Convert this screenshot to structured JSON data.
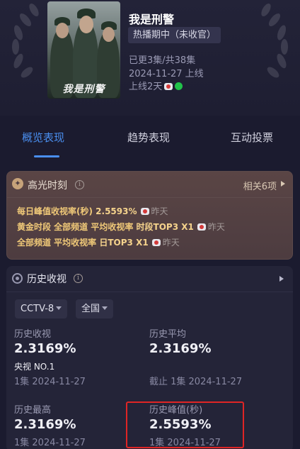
{
  "show": {
    "title": "我是刑警",
    "poster_text": "我是刑警",
    "status": "热播期中（未收官）",
    "episodes": "已更3集/共38集",
    "premiere": "2024-11-27 上线",
    "online_days": "上线2天"
  },
  "tabs": [
    {
      "label": "概览表现",
      "active": true
    },
    {
      "label": "趋势表现",
      "active": false
    },
    {
      "label": "互动投票",
      "active": false
    }
  ],
  "highlights": {
    "title": "高光时刻",
    "info_glyph": "i",
    "related": "相关6项",
    "items": [
      {
        "label": "每日峰值收视率(秒)",
        "value": "2.5593%",
        "when": "昨天"
      },
      {
        "label": "黄金时段 全部频道 平均收视率",
        "value": "时段TOP3 X1",
        "when": "昨天"
      },
      {
        "label": "全部频道 平均收视率",
        "value": "日TOP3 X1",
        "when": "昨天"
      }
    ]
  },
  "history": {
    "title": "历史收视",
    "info_glyph": "i",
    "filters": {
      "channel": "CCTV-8",
      "region": "全国"
    },
    "stats": [
      {
        "label": "历史收视",
        "value": "2.3169%",
        "sub": "央视 NO.1",
        "note": "1集 2024-11-27"
      },
      {
        "label": "历史平均",
        "value": "2.3169%",
        "sub": "",
        "note": "截止 1集 2024-11-27"
      },
      {
        "label": "历史最高",
        "value": "2.3169%",
        "sub": "",
        "note": "1集 2024-11-27"
      },
      {
        "label": "历史峰值(秒)",
        "value": "2.5593%",
        "sub": "",
        "note": "1集 2024-11-27"
      }
    ]
  },
  "colors": {
    "accent": "#4a8ff0",
    "highlight_gold": "#f0c978",
    "annotation_red": "#e02525"
  }
}
